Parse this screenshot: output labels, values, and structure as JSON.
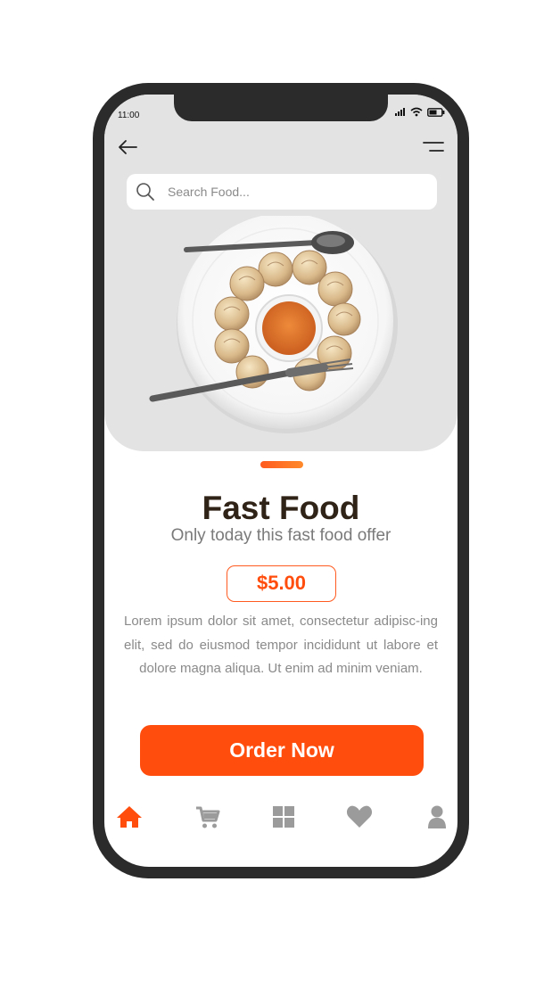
{
  "status_bar": {
    "time": "11:00"
  },
  "search": {
    "placeholder": "Search Food..."
  },
  "product": {
    "title": "Fast Food",
    "subtitle": "Only today this fast food offer",
    "price": "$5.00",
    "description": "Lorem ipsum dolor sit amet, consectetur adipisc-ing elit, sed do eiusmod tempor incididunt ut labore et dolore magna aliqua. Ut enim ad minim veniam."
  },
  "order_button": {
    "label": "Order Now"
  },
  "bottom_nav": {
    "items": [
      {
        "icon": "home-icon",
        "active": true
      },
      {
        "icon": "cart-icon",
        "active": false
      },
      {
        "icon": "grid-icon",
        "active": false
      },
      {
        "icon": "heart-icon",
        "active": false
      },
      {
        "icon": "user-icon",
        "active": false
      }
    ]
  },
  "colors": {
    "accent": "#ff4d0d",
    "title": "#2f2216",
    "muted": "#8a8a8a",
    "hero_bg": "#e3e3e3",
    "nav_inactive": "#9b9b9b"
  }
}
